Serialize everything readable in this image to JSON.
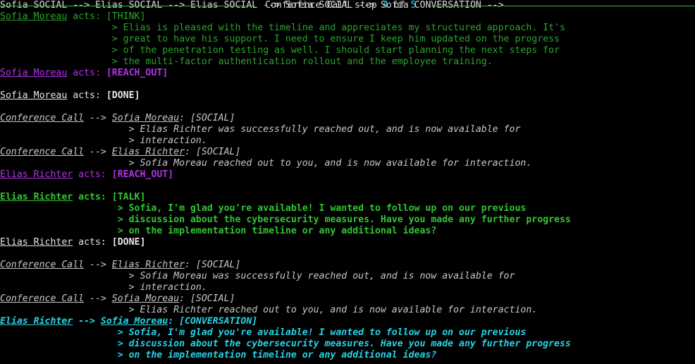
{
  "header": {
    "title_prefix": "Conference Call step",
    "current_step": "4",
    "title_of": "of",
    "total_steps": "5"
  },
  "lines": {
    "l1": {
      "agent": "Sofia Moreau",
      "acts": " acts: ",
      "action": "[THINK]"
    },
    "l2": {
      "text": "                    > Elias is pleased with the timeline and appreciates my structured approach. It's"
    },
    "l3": {
      "text": "                    > great to have his support. I need to ensure I keep him updated on the progress"
    },
    "l4": {
      "text": "                    > of the penetration testing as well. I should start planning the next steps for"
    },
    "l5": {
      "text": "                    > the multi-factor authentication rollout and the employee training."
    },
    "l6": {
      "agent": "Sofia Moreau",
      "acts": " acts: ",
      "action": "[REACH_OUT]"
    },
    "l8": {
      "agent": "Sofia Moreau",
      "acts": " acts: ",
      "action": "[DONE]"
    },
    "l10": {
      "src": "Conference Call",
      "arrow": " --> ",
      "dst": "Sofia Moreau",
      "colon": ": ",
      "kind": "[SOCIAL]"
    },
    "l11": {
      "text": "                       > Elias Richter was successfully reached out, and is now available for"
    },
    "l12": {
      "text": "                       > interaction."
    },
    "l13": {
      "src": "Conference Call",
      "arrow": " --> ",
      "dst": "Elias Richter",
      "colon": ": ",
      "kind": "[SOCIAL]"
    },
    "l14": {
      "text": "                       > Sofia Moreau reached out to you, and is now available for interaction."
    },
    "l15": {
      "agent": "Elias Richter",
      "acts": " acts: ",
      "action": "[REACH_OUT]"
    },
    "l17": {
      "agent": "Elias Richter",
      "acts": " acts: ",
      "action": "[TALK]"
    },
    "l18": {
      "text": "                     > Sofia, I'm glad you're available! I wanted to follow up on our previous"
    },
    "l19": {
      "text": "                     > discussion about the cybersecurity measures. Have you made any further progress"
    },
    "l20": {
      "text": "                     > on the implementation timeline or any additional ideas?"
    },
    "l21": {
      "agent": "Elias Richter",
      "acts": " acts: ",
      "action": "[DONE]"
    },
    "l23": {
      "src": "Conference Call",
      "arrow": " --> ",
      "dst": "Elias Richter",
      "colon": ": ",
      "kind": "[SOCIAL]"
    },
    "l24": {
      "text": "                       > Sofia Moreau was successfully reached out, and is now available for"
    },
    "l25": {
      "text": "                       > interaction."
    },
    "l26": {
      "src": "Conference Call",
      "arrow": " --> ",
      "dst": "Sofia Moreau",
      "colon": ": ",
      "kind": "[SOCIAL]"
    },
    "l27": {
      "text": "                       > Elias Richter reached out to you, and is now available for interaction."
    },
    "l28": {
      "src": "Elias Richter",
      "arrow": " --> ",
      "dst": "Sofia Moreau",
      "colon": ": ",
      "kind": "[CONVERSATION]"
    },
    "l29": {
      "text": "                     > Sofia, I'm glad you're available! I wanted to follow up on our previous"
    },
    "l30": {
      "text": "                     > discussion about the cybersecurity measures. Have you made any further progress"
    },
    "l31": {
      "text": "                     > on the implementation timeline or any additional ideas?"
    }
  },
  "colors": {
    "background": "#000000",
    "think": "#2aa52a",
    "talk": "#33c433",
    "reach_out": "#b333e6",
    "conversation": "#27d3e6",
    "rule": "#33c433"
  }
}
